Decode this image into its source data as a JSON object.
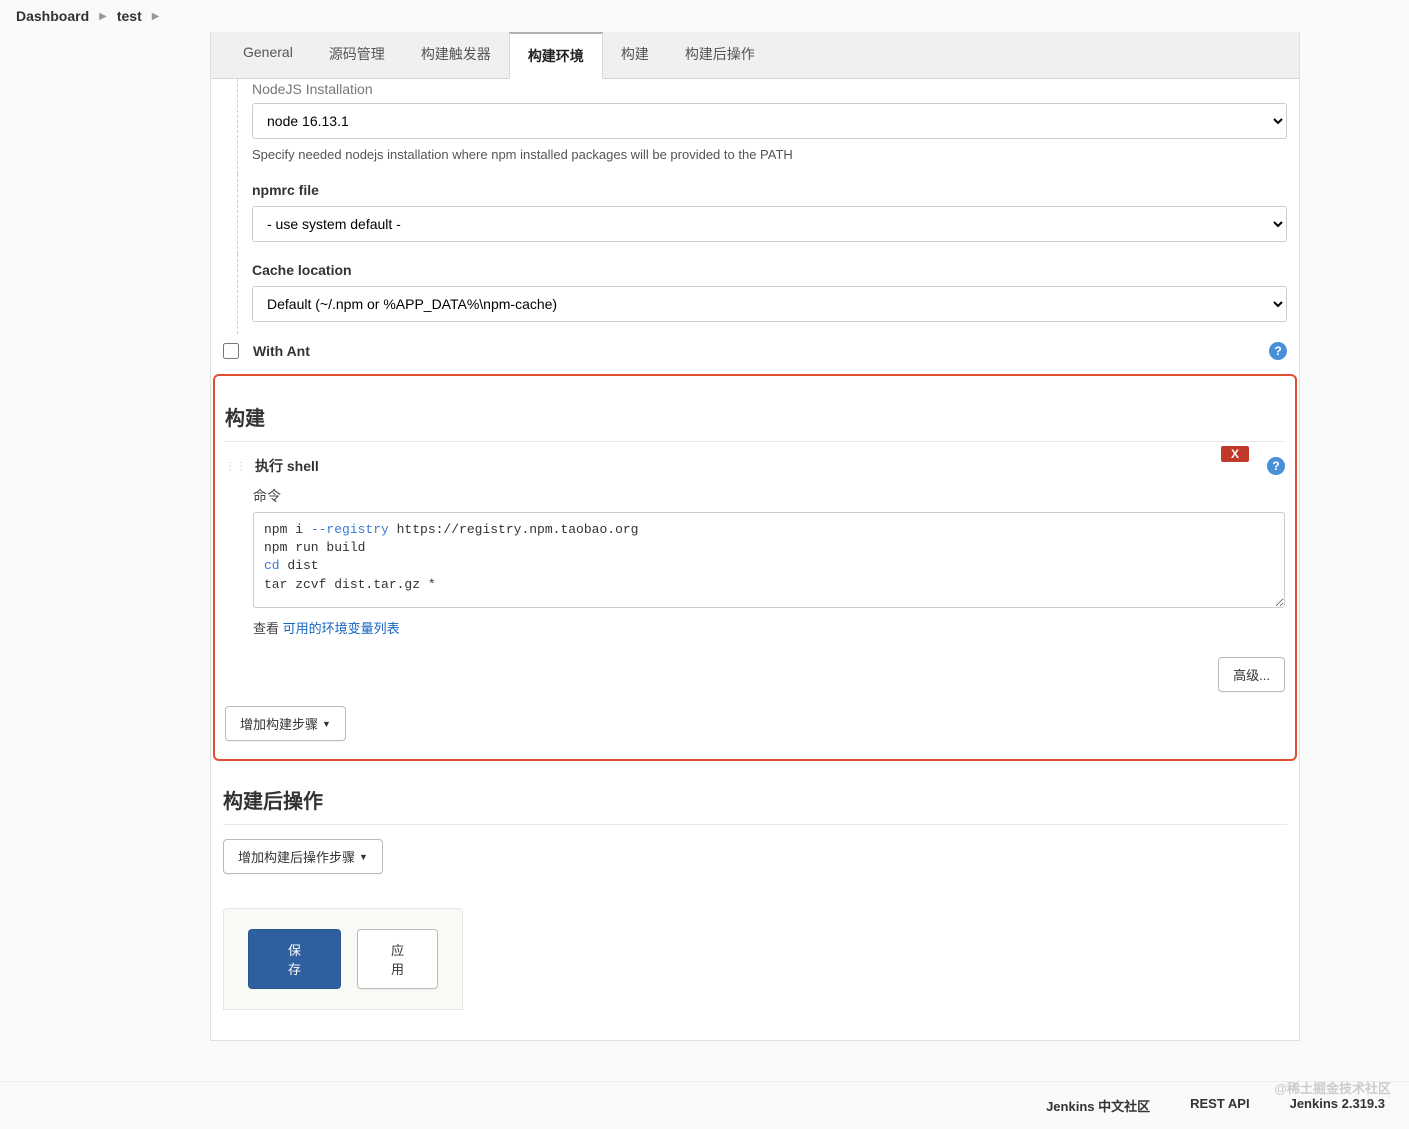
{
  "breadcrumb": {
    "dashboard": "Dashboard",
    "project": "test"
  },
  "tabs": {
    "general": "General",
    "scm": "源码管理",
    "triggers": "构建触发器",
    "env": "构建环境",
    "build": "构建",
    "post": "构建后操作"
  },
  "nodejs": {
    "cutoff_label": "NodeJS Installation",
    "select": "node 16.13.1",
    "helper": "Specify needed nodejs installation where npm installed packages will be provided to the PATH",
    "npmrc_label": "npmrc file",
    "npmrc_select": "- use system default -",
    "cache_label": "Cache location",
    "cache_select": "Default (~/.npm or %APP_DATA%\\npm-cache)"
  },
  "with_ant": "With Ant",
  "build_section": "构建",
  "shell": {
    "title": "执行 shell",
    "close": "X",
    "cmd_label": "命令",
    "code_line1_pre": "npm i ",
    "code_line1_flag": "--registry",
    "code_line1_post": " https://registry.npm.taobao.org",
    "code_line2": "npm run build",
    "code_line3_pre": "cd ",
    "code_line3_post": "dist",
    "code_line4": "tar zcvf dist.tar.gz *",
    "env_prefix": "查看 ",
    "env_link": "可用的环境变量列表",
    "advanced": "高级..."
  },
  "add_build_step": "增加构建步骤",
  "post_section": "构建后操作",
  "add_post_step": "增加构建后操作步骤",
  "actions": {
    "save": "保存",
    "apply": "应用"
  },
  "footer": {
    "cn_community": "Jenkins 中文社区",
    "rest_api": "REST API",
    "version": "Jenkins 2.319.3",
    "watermark": "@稀土掘金技术社区"
  }
}
